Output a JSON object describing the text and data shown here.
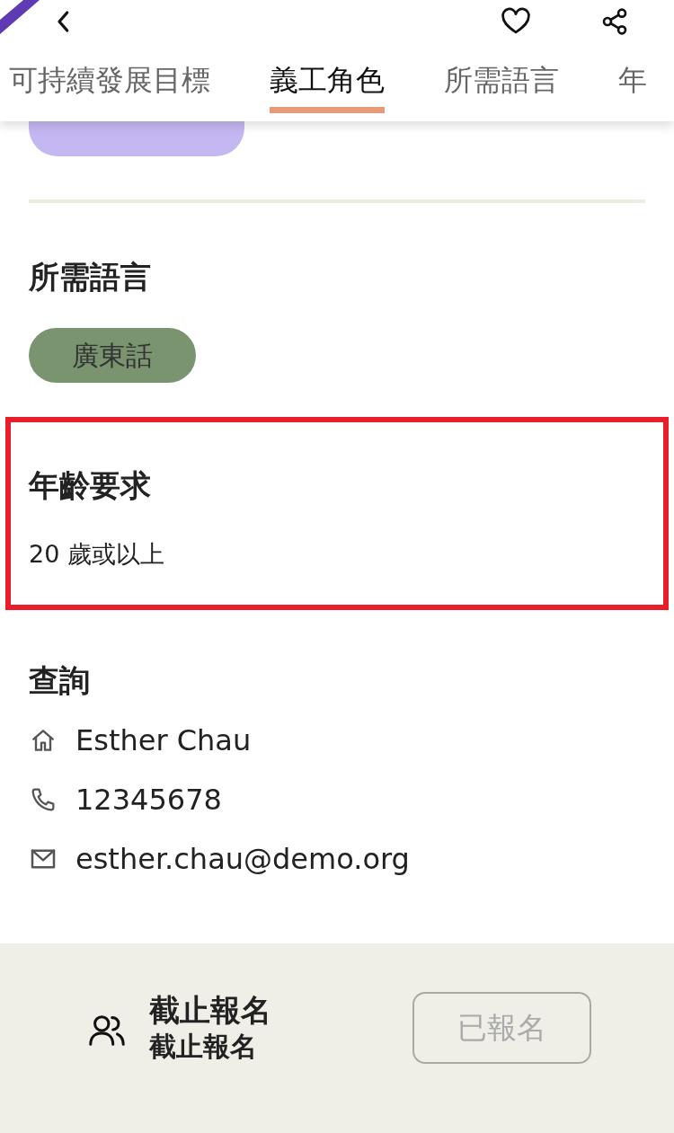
{
  "header": {
    "tabs": [
      {
        "label": "可持續發展目標",
        "selected": false
      },
      {
        "label": "義工角色",
        "selected": true
      },
      {
        "label": "所需語言",
        "selected": false
      },
      {
        "label": "年",
        "selected": false
      }
    ]
  },
  "role_chips": [
    {
      "color": "#c5b8f2"
    }
  ],
  "sections": [
    {
      "title": "所需語言",
      "kind": "chips",
      "chips": [
        {
          "label": "廣東話",
          "color": "#7a9470"
        }
      ],
      "highlighted": false
    },
    {
      "title": "年齡要求",
      "kind": "text",
      "text": "20 歲或以上",
      "highlighted": true
    },
    {
      "title": "查詢",
      "kind": "contacts",
      "contacts": [
        {
          "kind": "home",
          "text": "Esther Chau"
        },
        {
          "kind": "phone",
          "text": "12345678"
        },
        {
          "kind": "email",
          "text": "esther.chau@demo.org"
        }
      ],
      "highlighted": false
    }
  ],
  "footer": {
    "status_title": "截止報名",
    "status_subtitle": "截止報名",
    "button": {
      "label": "已報名",
      "disabled": true
    }
  }
}
